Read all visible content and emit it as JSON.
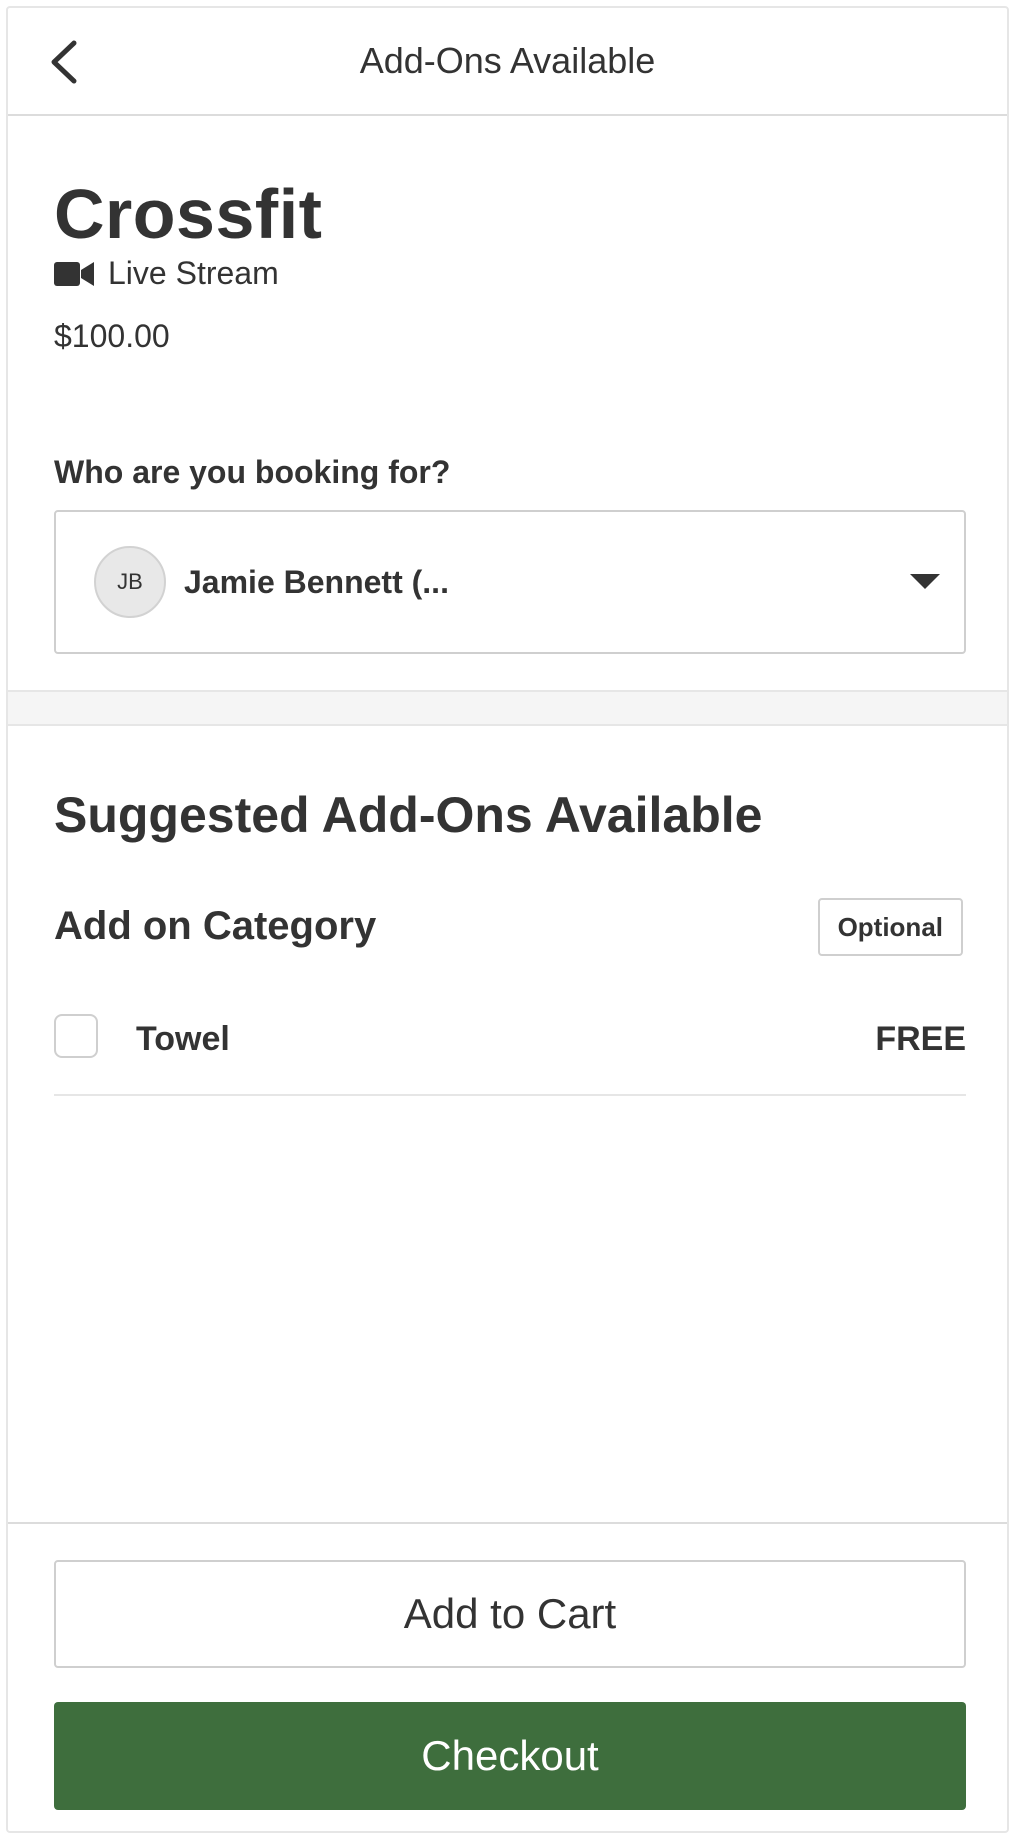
{
  "header": {
    "title": "Add-Ons Available",
    "back_icon": "chevron-left-icon"
  },
  "class": {
    "title": "Crossfit",
    "stream_icon": "video-camera-icon",
    "stream_label": "Live Stream",
    "price": "$100.00"
  },
  "booking": {
    "label": "Who are you booking for?",
    "avatar_initials": "JB",
    "selected_value": "Jamie Bennett (...",
    "dropdown_icon": "caret-down-icon"
  },
  "addons": {
    "heading": "Suggested Add-Ons Available",
    "category": {
      "title": "Add on Category",
      "badge": "Optional",
      "items": [
        {
          "label": "Towel",
          "price": "FREE",
          "checked": false
        }
      ]
    }
  },
  "footer": {
    "add_to_cart_label": "Add to Cart",
    "checkout_label": "Checkout"
  },
  "colors": {
    "primary": "#3e6e3d",
    "text": "#333333",
    "border": "#cfcfcf"
  }
}
